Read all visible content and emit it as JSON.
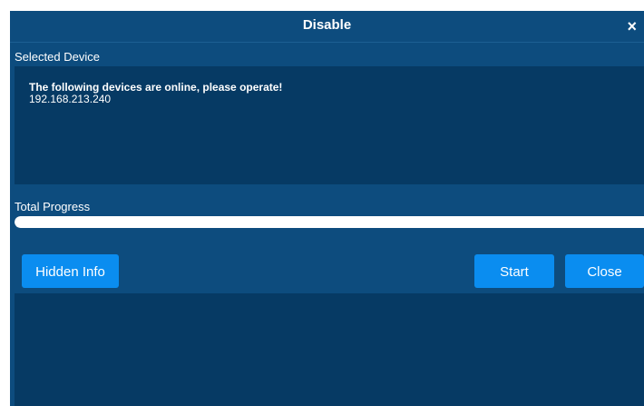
{
  "dialog": {
    "title": "Disable",
    "close_glyph": "×"
  },
  "selected_device": {
    "label": "Selected Device",
    "heading": "The following devices are online, please operate!",
    "devices": [
      "192.168.213.240"
    ]
  },
  "progress": {
    "label": "Total Progress",
    "value_percent": 100
  },
  "buttons": {
    "hidden_info": "Hidden Info",
    "start": "Start",
    "close": "Close"
  },
  "colors": {
    "dialog_bg": "#0d4c7e",
    "panel_bg": "#063a64",
    "button_bg": "#0a8df0",
    "progress_fill": "#ffffff"
  },
  "icons": {
    "close": "close-icon"
  }
}
